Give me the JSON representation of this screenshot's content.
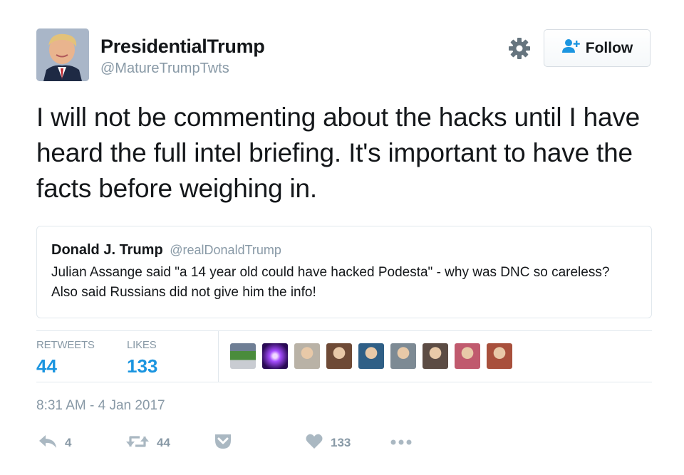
{
  "user": {
    "display_name": "PresidentialTrump",
    "handle": "@MatureTrumpTwts"
  },
  "follow_button": {
    "label": "Follow",
    "icon": "follow-person-plus-icon"
  },
  "settings_icon": "gear-icon",
  "tweet": {
    "text": "I will not be commenting about the hacks until I have heard the full intel briefing. It's important to have the facts before weighing in."
  },
  "quoted_tweet": {
    "name": "Donald J. Trump",
    "handle": "@realDonaldTrump",
    "text": "Julian Assange said \"a 14 year old could have hacked Podesta\" - why was DNC so careless? Also said Russians did not give him the info!"
  },
  "stats": {
    "retweets_label": "RETWEETS",
    "retweets_value": "44",
    "likes_label": "LIKES",
    "likes_value": "133"
  },
  "likers": [
    {
      "name": "liker-avatar-obama-cheer",
      "color": "#9aa6b5"
    },
    {
      "name": "liker-avatar-purple-orb",
      "color": "#6a2bd8"
    },
    {
      "name": "liker-avatar-sketch-portrait",
      "color": "#b9b2a6"
    },
    {
      "name": "liker-avatar-woman-hair",
      "color": "#6e4a36"
    },
    {
      "name": "liker-avatar-man-blue",
      "color": "#2f5f86"
    },
    {
      "name": "liker-avatar-group",
      "color": "#7d8a94"
    },
    {
      "name": "liker-avatar-man-beard",
      "color": "#5c4c44"
    },
    {
      "name": "liker-avatar-woman-red",
      "color": "#c05a6e"
    },
    {
      "name": "liker-avatar-man-red",
      "color": "#a8503c"
    }
  ],
  "timestamp": "8:31 AM - 4 Jan 2017",
  "actions": {
    "reply_count": "4",
    "retweet_count": "44",
    "like_count": "133"
  },
  "colors": {
    "accent": "#1b95e0",
    "muted": "#8899a6",
    "text": "#14171a",
    "border": "#e1e8ed"
  }
}
